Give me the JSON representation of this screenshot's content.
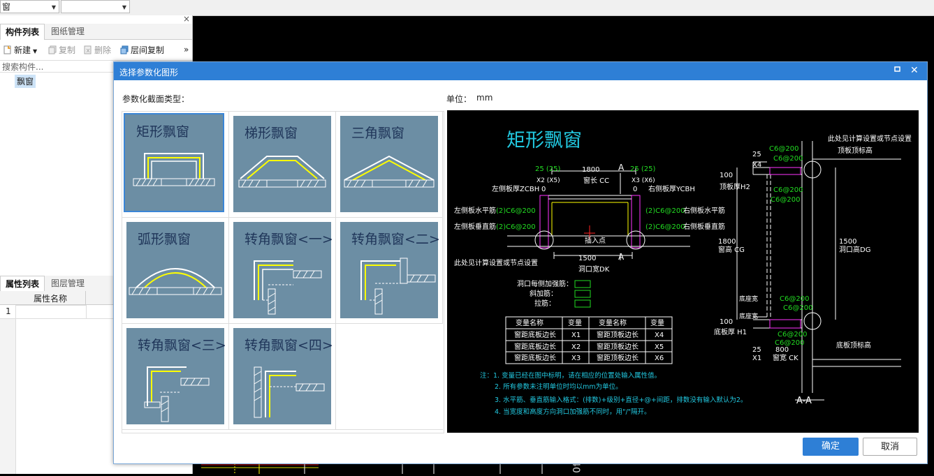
{
  "toolbar": {
    "combo1_value": "窗",
    "combo2_value": ""
  },
  "left_panel": {
    "close_glyph": "×",
    "tabs_top": [
      "构件列表",
      "图纸管理"
    ],
    "actions": {
      "new": "新建",
      "copy": "复制",
      "delete": "删除",
      "floor_copy": "层间复制",
      "more": "»"
    },
    "search_placeholder": "搜索构件...",
    "component": "飘窗",
    "tabs_bottom": [
      "属性列表",
      "图层管理"
    ],
    "prop_header": "属性名称",
    "prop_row_number": "1"
  },
  "dialog": {
    "title": "选择参数化图形",
    "section_label": "参数化截面类型：",
    "unit_label": "单位：",
    "unit_value": "mm",
    "shapes": [
      "矩形飘窗",
      "梯形飘窗",
      "三角飘窗",
      "弧形飘窗",
      "转角飘窗<一>",
      "转角飘窗<二>",
      "转角飘窗<三>",
      "转角飘窗<四>"
    ],
    "selected_shape": "矩形飘窗",
    "ok": "确定",
    "cancel": "取消"
  },
  "preview": {
    "title": "矩形飘窗",
    "section_mark": "A",
    "section_name": "A-A",
    "dims": {
      "top_left": "25 (25)",
      "top_width": "1800",
      "top_right": "25 (25)",
      "x2x5": "X2 (X5)",
      "window_len": "窗长 CC",
      "x3x6": "X3 (X6)",
      "zero_l": "0",
      "zero_r": "0",
      "left_board": "左侧板厚ZCBH",
      "right_board": "右侧板厚YCBH",
      "bottom_width": "1500",
      "hole_width": "洞口宽DK",
      "insert": "插入点"
    },
    "rebar": {
      "left_h": "左侧板水平筋",
      "left_v": "左侧板垂直筋",
      "right_h": "右侧板水平筋",
      "right_v": "右侧板垂直筋",
      "l_h_val": "(2)C6@200",
      "l_v_val": "(2)C6@200",
      "r_h_val": "(2)C6@200",
      "r_v_val": "(2)C6@200"
    },
    "note_calc": "此处见计算设置或节点设置",
    "legend": [
      "洞口每侧加强筋：",
      "斜加筋：",
      "拉筋："
    ],
    "var_headers": [
      "变量名称",
      "变量",
      "变量名称",
      "变量"
    ],
    "var_rows": [
      [
        "窗距底板边长",
        "X1",
        "窗距顶板边长",
        "X4"
      ],
      [
        "窗距底板边长",
        "X2",
        "窗距顶板边长",
        "X5"
      ],
      [
        "窗距底板边长",
        "X3",
        "窗距顶板边长",
        "X6"
      ]
    ],
    "notes": [
      "注：1. 变量已经在图中标明，请在相应的位置处输入属性值。",
      "2. 所有参数未注明单位时均以mm为单位。",
      "3. 水平筋、垂直筋输入格式：(排数)+级别+直径+@+间距，排数没有输入默认为2。",
      "4. 当宽度和高度方向洞口加强筋不同时，用\"/\"隔开。"
    ],
    "right": {
      "calc_note": "此处见计算设置或节点设置",
      "top_elev": "顶板顶标高",
      "x4": "X4",
      "d25a": "25",
      "c6a": "C6@200",
      "c6b": "C6@200",
      "c6c": "C6@200",
      "c6d": "C6@200",
      "d100a": "100",
      "top_thick": "顶板厚H2",
      "d1800": "1800",
      "win_h": "窗高 CG",
      "d1500": "1500",
      "hole_h": "洞口高DG",
      "bottom_left1": "底座宽",
      "bottom_left2": "底座宽",
      "c6e": "C6@200",
      "c6f": "C6@200",
      "d100b": "100",
      "bottom_thick": "底板厚 H1",
      "c6g": "C6@200",
      "c6h": "C6@200",
      "bot_elev": "底板顶标高",
      "d25b": "25",
      "d800": "800",
      "x1": "X1",
      "win_w": "窗宽 CK"
    }
  },
  "canvas": {
    "digits": "40"
  },
  "colors": {
    "title_bar": "#2e7fd6",
    "thumb_bg": "#6c8ea4",
    "cad_cyan": "#22c8e0",
    "cad_green": "#22dd22",
    "cad_magenta": "#ff33ff"
  }
}
